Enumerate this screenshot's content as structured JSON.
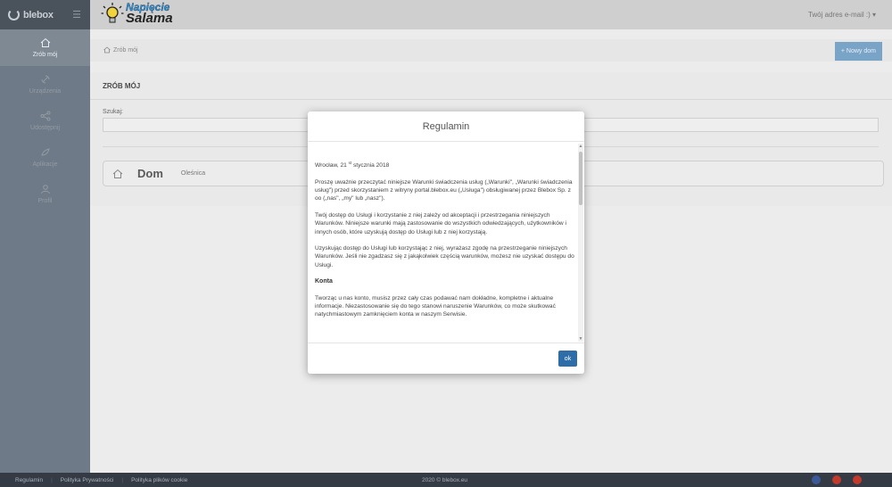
{
  "sidebar": {
    "logo": "blebox",
    "items": [
      {
        "label": "Zrób mój",
        "icon": "home-icon",
        "active": true
      },
      {
        "label": "Urządzenia",
        "icon": "devices-icon"
      },
      {
        "label": "Udostępnij",
        "icon": "share-icon"
      },
      {
        "label": "Aplikacje",
        "icon": "apps-icon"
      },
      {
        "label": "Profil",
        "icon": "profile-icon"
      }
    ]
  },
  "header": {
    "brand_line1": "Napięcie",
    "brand_line2": "Salama",
    "user_email": "Twój adres e-mail :) ▾"
  },
  "breadcrumb": {
    "label": "Zrób mój",
    "new_button": "+ Nowy dom"
  },
  "main": {
    "title": "ZRÓB MÓJ",
    "search_label": "Szukaj:",
    "search_value": "",
    "home": {
      "name": "Dom",
      "location": "Oleśnica"
    }
  },
  "modal": {
    "title": "Regulamin",
    "date_prefix": "Wrocław, 21 ",
    "date_sup": "st",
    "date_suffix": " stycznia 2018",
    "p1": "Proszę uważnie przeczytać niniejsze Warunki świadczenia usług („Warunki\", „Warunki świadczenia usług\") przed skorzystaniem z witryny portal.blebox.eu („Usługa\") obsługiwanej przez Blebox Sp. z oo („nas\", „my\" lub „nasz\").",
    "p2": "Twój dostęp do Usługi i korzystanie z niej zależy od akceptacji i przestrzegania niniejszych Warunków. Niniejsze warunki mają zastosowanie do wszystkich odwiedzających, użytkowników i innych osób, które uzyskują dostęp do Usługi lub z niej korzystają.",
    "p3": "Uzyskując dostęp do Usługi lub korzystając z niej, wyrażasz zgodę na przestrzeganie niniejszych Warunków. Jeśli nie zgadzasz się z jakąkolwiek częścią warunków, możesz nie uzyskać dostępu do Usługi.",
    "section": "Konta",
    "p4": "Tworząc u nas konto, musisz przez cały czas podawać nam dokładne, kompletne i aktualne informacje. Niezastosowanie się do tego stanowi naruszenie Warunków, co może skutkować natychmiastowym zamknięciem konta w naszym Serwisie.",
    "ok_label": "ok"
  },
  "footer": {
    "links": [
      "Regulamin",
      "Polityka Prywatności",
      "Polityka plików cookie"
    ],
    "copyright": "2020 © blebox.eu",
    "social": [
      {
        "icon": "facebook-icon",
        "color": "#3b5998"
      },
      {
        "icon": "googleplus-icon",
        "color": "#c23a2b"
      },
      {
        "icon": "youtube-icon",
        "color": "#c23a2b"
      }
    ]
  }
}
